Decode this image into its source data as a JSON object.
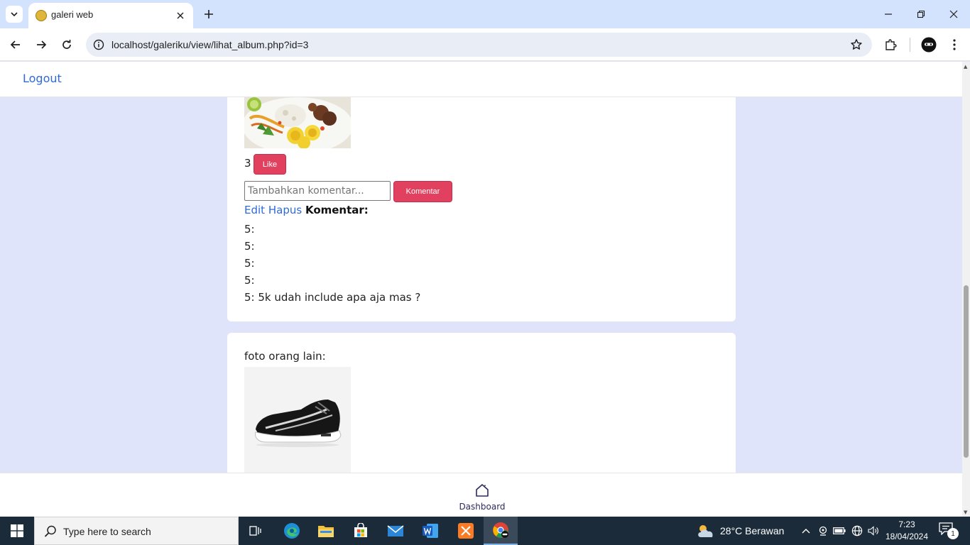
{
  "browser": {
    "tab_title": "galeri web",
    "url": "localhost/galeriku/view/lihat_album.php?id=3"
  },
  "topnav": {
    "logout": "Logout"
  },
  "post": {
    "like_count": "3",
    "like_label": "Like",
    "comment_placeholder": "Tambahkan komentar...",
    "comment_button": "Komentar",
    "edit_label": "Edit",
    "delete_label": "Hapus",
    "comments_heading": "Komentar:",
    "comments": [
      "5:",
      "5:",
      "5:",
      "5:",
      "5: 5k udah include apa aja mas ?"
    ]
  },
  "others": {
    "title": "foto orang lain:"
  },
  "bottomnav": {
    "dashboard": "Dashboard"
  },
  "taskbar": {
    "search_placeholder": "Type here to search",
    "weather": "28°C  Berawan",
    "time": "7:23",
    "date": "18/04/2024",
    "notification_count": "1"
  },
  "colors": {
    "page_bg": "#dfe4fb",
    "accent_button": "#e2405f",
    "link": "#2f6ad9",
    "taskbar": "#1c2b3a"
  }
}
